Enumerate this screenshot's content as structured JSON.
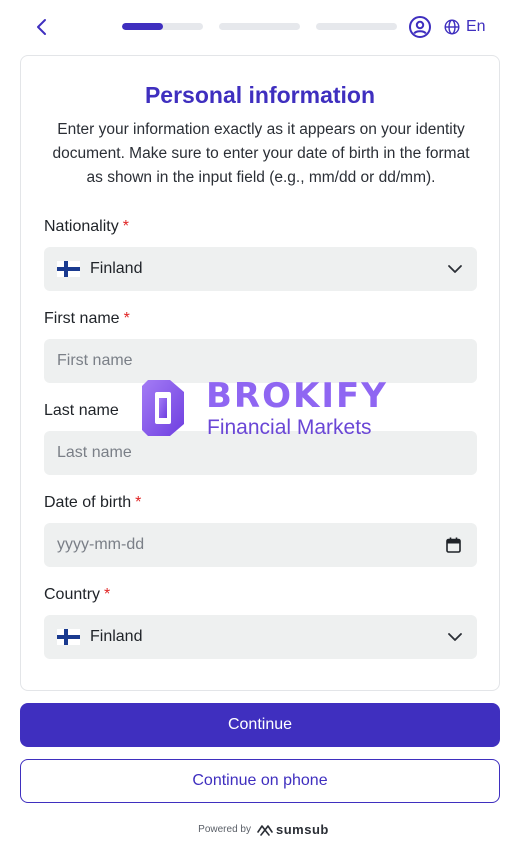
{
  "header": {
    "progress": [
      {
        "fraction": 0.5
      },
      {
        "fraction": 0
      },
      {
        "fraction": 0
      }
    ],
    "language": "En",
    "icons": {
      "back": "chevron-left-icon",
      "user": "user-circle-icon",
      "language": "globe-icon"
    }
  },
  "form": {
    "title": "Personal information",
    "subtitle": "Enter your information exactly as it appears on your identity document. Make sure to enter your date of birth in the format as shown in the input field (e.g., mm/dd or dd/mm).",
    "nationality": {
      "label": "Nationality",
      "required": "*",
      "value": "Finland",
      "flag": "finland-flag-icon"
    },
    "first_name": {
      "label": "First name",
      "required": "*",
      "placeholder": "First name"
    },
    "last_name": {
      "label": "Last name",
      "placeholder": "Last name"
    },
    "dob": {
      "label": "Date of birth",
      "required": "*",
      "placeholder": "yyyy-mm-dd"
    },
    "country": {
      "label": "Country",
      "required": "*",
      "value": "Finland",
      "flag": "finland-flag-icon"
    }
  },
  "watermark": {
    "brand": "BROKIFY",
    "sub": "Financial Markets"
  },
  "actions": {
    "continue": "Continue",
    "continue_phone": "Continue on phone"
  },
  "footer": {
    "powered_by": "Powered by",
    "brand": "sumsub"
  },
  "colors": {
    "accent": "#3f2fbf",
    "required": "#e02424",
    "field_bg": "#eef0f0"
  }
}
